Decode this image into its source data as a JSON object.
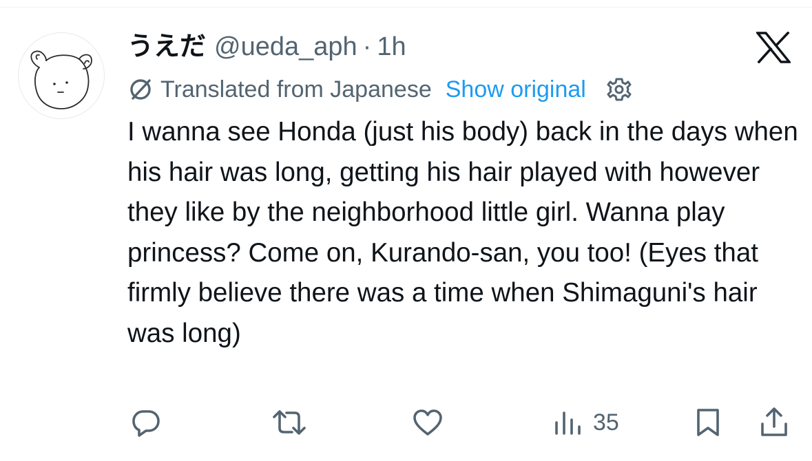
{
  "post": {
    "display_name": "うえだ",
    "handle": "@ueda_aph",
    "separator": "·",
    "time": "1h",
    "translation": {
      "label": "Translated from Japanese",
      "show_original": "Show original"
    },
    "text": "I wanna see Honda (just his body) back in the days when his hair was long, getting his hair played with however they like by the neighborhood little girl. Wanna play princess? Come on, Kurando-san, you too! (Eyes that firmly believe there was a time when Shimaguni's hair was long)"
  },
  "actions": {
    "views": "35"
  },
  "icons": {
    "brand": "x-logo",
    "reply": "reply-icon",
    "repost": "repost-icon",
    "like": "heart-icon",
    "views": "views-icon",
    "bookmark": "bookmark-icon",
    "share": "share-icon",
    "translate": "globe-icon",
    "settings": "gear-icon"
  },
  "colors": {
    "text_primary": "#0f1419",
    "text_secondary": "#536471",
    "accent": "#1d9bf0"
  }
}
